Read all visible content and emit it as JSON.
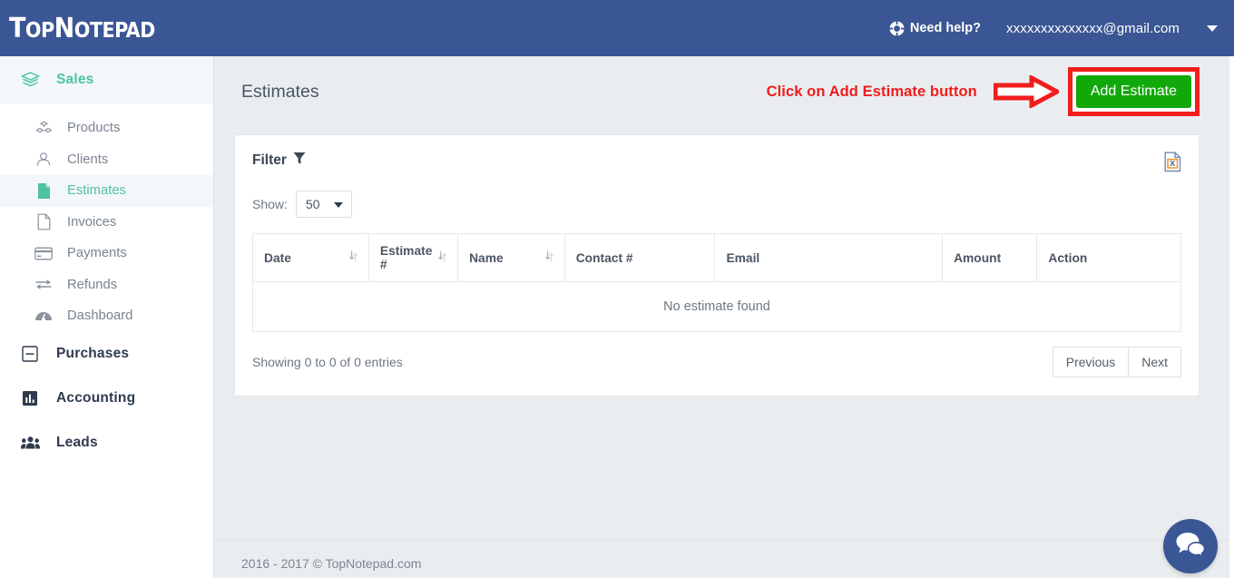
{
  "header": {
    "logo_top": "T",
    "logo_text_1": "OP",
    "logo_text_2": "N",
    "logo_text_3": "OTEPAD",
    "logo_full": "TopNotepad",
    "need_help_label": "Need help?",
    "help_icon": "life-ring-icon",
    "user_email": "xxxxxxxxxxxxxx@gmail.com",
    "caret_icon": "chevron-down-icon",
    "background_color": "#3a5694"
  },
  "sidebar": {
    "group": {
      "label": "Sales",
      "icon": "layers-icon",
      "active": true,
      "color": "#4ec2a2"
    },
    "items": [
      {
        "label": "Products",
        "icon": "cubes-icon",
        "active": false
      },
      {
        "label": "Clients",
        "icon": "user-circle-icon",
        "active": false
      },
      {
        "label": "Estimates",
        "icon": "file-icon",
        "active": true
      },
      {
        "label": "Invoices",
        "icon": "file-outline-icon",
        "active": false
      },
      {
        "label": "Payments",
        "icon": "credit-card-icon",
        "active": false
      },
      {
        "label": "Refunds",
        "icon": "exchange-icon",
        "active": false
      },
      {
        "label": "Dashboard",
        "icon": "tachometer-icon",
        "active": false
      }
    ],
    "sections": [
      {
        "label": "Purchases",
        "icon": "minus-square-icon"
      },
      {
        "label": "Accounting",
        "icon": "bar-chart-icon"
      },
      {
        "label": "Leads",
        "icon": "users-icon"
      }
    ]
  },
  "main": {
    "page_title": "Estimates",
    "annotation_text": "Click on Add Estimate button",
    "annotation_color": "#f21d1d",
    "add_button_label": "Add Estimate",
    "add_button_color": "#11a80a"
  },
  "card": {
    "filter_label": "Filter",
    "filter_icon": "funnel-icon",
    "export_icon": "excel-file-icon",
    "show_label": "Show:",
    "show_value": "50",
    "show_options": [
      "50"
    ],
    "table": {
      "columns": [
        {
          "label": "Date",
          "sortable": true
        },
        {
          "label": "Estimate #",
          "sortable": true
        },
        {
          "label": "Name",
          "sortable": true
        },
        {
          "label": "Contact #",
          "sortable": false
        },
        {
          "label": "Email",
          "sortable": false
        },
        {
          "label": "Amount",
          "sortable": false
        },
        {
          "label": "Action",
          "sortable": false
        }
      ],
      "rows": [],
      "empty_message": "No estimate found"
    },
    "entries_info": "Showing 0 to 0 of 0 entries",
    "pagination": {
      "previous_label": "Previous",
      "next_label": "Next"
    }
  },
  "footer": {
    "copyright": "2016 - 2017 © TopNotepad.com"
  },
  "chat": {
    "icon": "chat-bubbles-icon",
    "color": "#3a5694"
  }
}
